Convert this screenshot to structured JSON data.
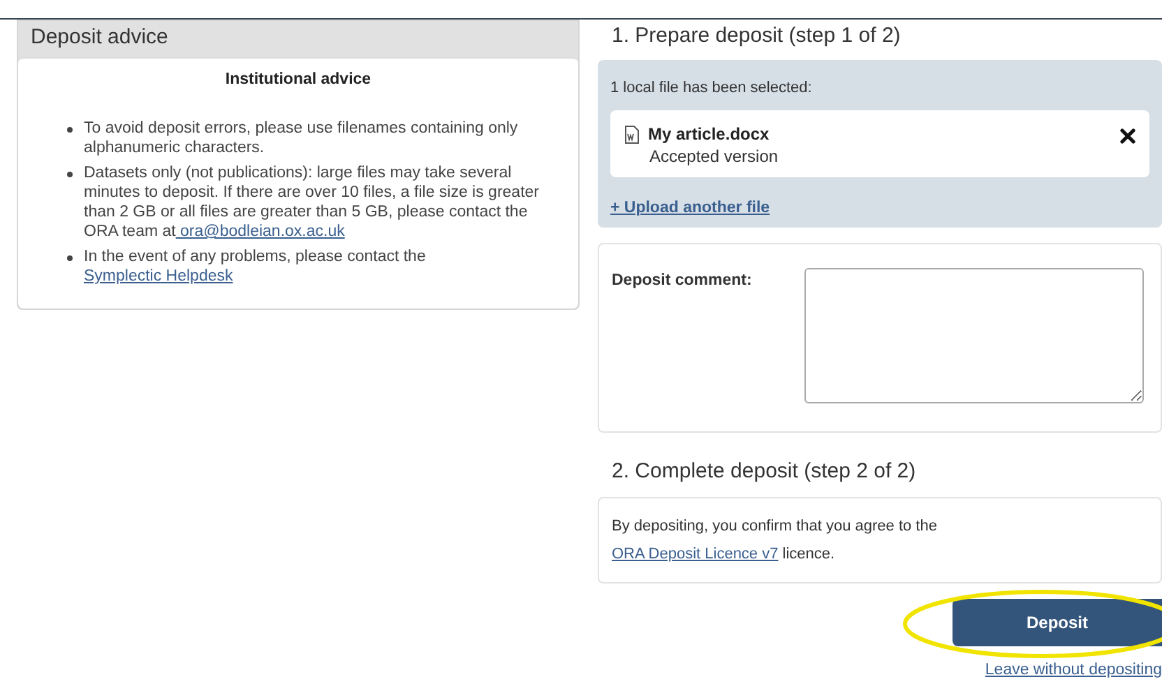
{
  "advice_panel": {
    "title": "Deposit advice",
    "heading": "Institutional advice",
    "items": [
      {
        "text": "To avoid deposit errors, please use filenames containing only alphanumeric characters."
      },
      {
        "text": "Datasets only (not publications):  large files may take several minutes to deposit. If there are over 10 files, a file size is greater than 2 GB or all files are greater than 5 GB, please contact the ORA team at",
        "link": " ora@bodleian.ox.ac.uk"
      },
      {
        "text": "In the event of any problems, please contact the ",
        "link": "Symplectic Helpdesk"
      }
    ]
  },
  "prepare": {
    "title": "1. Prepare deposit (step 1 of 2)",
    "status": "1 local file has been selected:",
    "files": [
      {
        "name": "My article.docx",
        "version": "Accepted version"
      }
    ],
    "upload_link": "+ Upload another file",
    "comment_label": "Deposit comment:"
  },
  "complete": {
    "title": "2. Complete deposit (step 2 of 2)",
    "text": "By depositing, you confirm that you agree to the",
    "link": "ORA Deposit Licence v7",
    "suffix": " licence.",
    "button": "Deposit",
    "leave_link": "Leave without depositing"
  }
}
